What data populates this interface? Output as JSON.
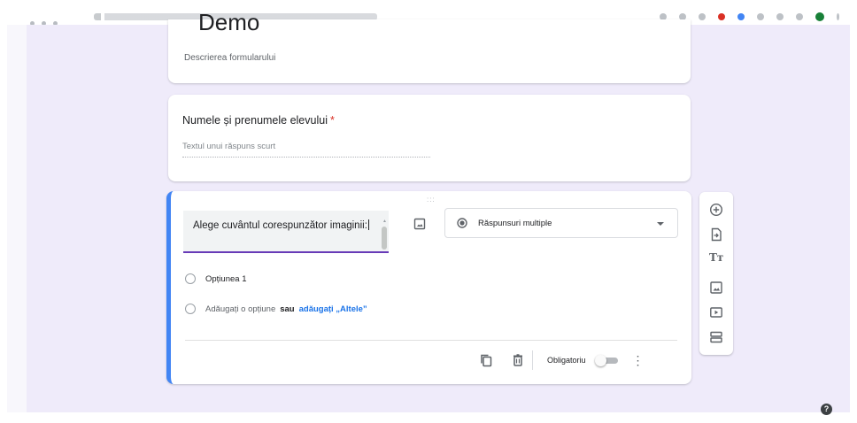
{
  "form": {
    "title": "Demo",
    "description": "Descrierea formularului"
  },
  "question1": {
    "title": "Numele și prenumele elevului",
    "required_mark": "*",
    "answer_placeholder": "Textul unui răspuns scurt"
  },
  "question2": {
    "drag_handle": ":::",
    "text": "Alege cuvântul corespunzător imaginii:",
    "type_label": "Răspunsuri multiple",
    "option1": "Opțiunea 1",
    "add_option": "Adăugați o opțiune",
    "or_label": "sau",
    "add_other": "adăugați „Altele”",
    "required_label": "Obligatoriu",
    "required_on": false,
    "kebab": "⋮"
  },
  "sidebar": {
    "icons": [
      "add-question-icon",
      "import-questions-icon",
      "add-title-icon",
      "add-image-icon",
      "add-video-icon",
      "add-section-icon"
    ],
    "title_glyph": "Tт"
  },
  "help": {
    "glyph": "?"
  },
  "colors": {
    "background": "#efebfa",
    "accent": "#673ab7",
    "active_border": "#4285f4",
    "required": "#d93025",
    "link": "#1a73e8"
  }
}
